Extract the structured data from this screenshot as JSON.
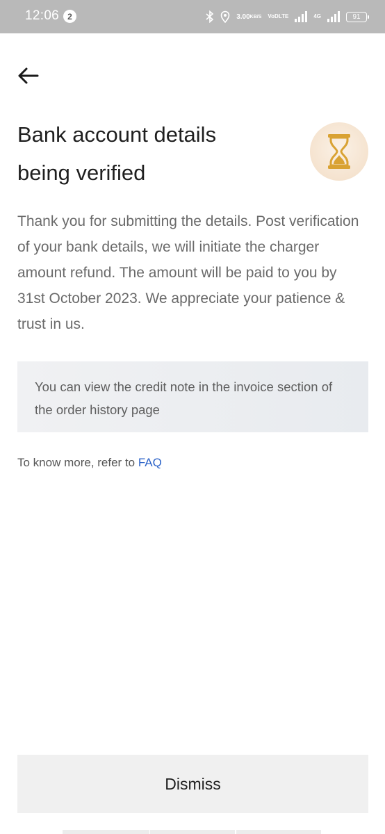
{
  "status_bar": {
    "time": "12:06",
    "notification_count": "2",
    "net_speed_value": "3.00",
    "net_speed_unit": "KB/S",
    "volte_top": "VoD",
    "volte_bottom": "LTE",
    "network_type": "4G",
    "battery": "91"
  },
  "header": {
    "back_icon": "arrow-left-icon"
  },
  "title": {
    "line1": "Bank account details",
    "line2": "being verified",
    "icon": "hourglass-icon",
    "icon_color": "#d9a233"
  },
  "body": {
    "message": "Thank you for submitting the details. Post verification of your bank details, we will initiate the charger amount refund. The amount will be paid to you by 31st October 2023. We appreciate your patience & trust in us."
  },
  "info_box": {
    "text": "You can view the credit note in the invoice section of the order history page"
  },
  "know_more": {
    "prefix": "To know more, refer to ",
    "link_label": "FAQ",
    "link_color": "#2c63c8"
  },
  "footer": {
    "dismiss_label": "Dismiss"
  }
}
